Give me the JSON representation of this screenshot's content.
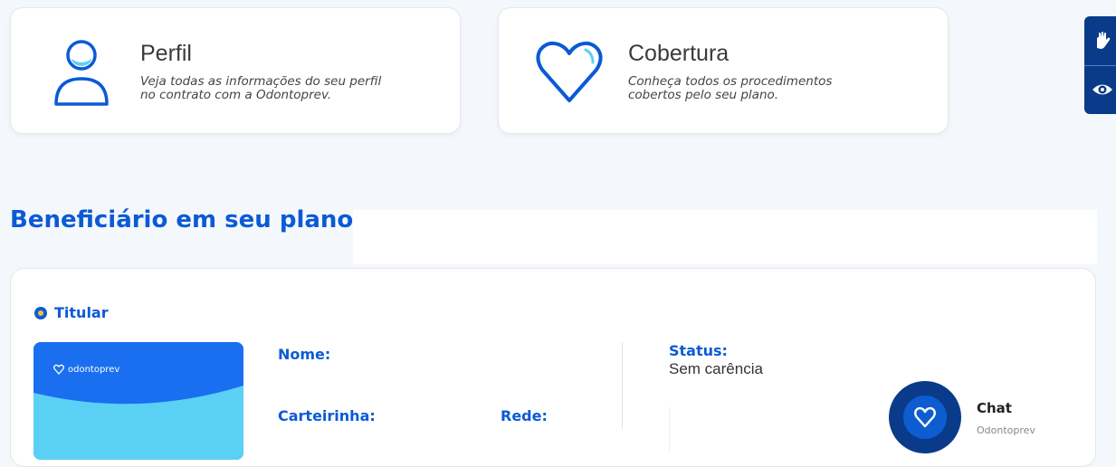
{
  "cards": {
    "perfil": {
      "title": "Perfil",
      "desc_line1": "Veja todas as informações do seu perfil",
      "desc_line2": "no contrato com a Odontoprev."
    },
    "cobertura": {
      "title": "Cobertura",
      "desc_line1": "Conheça todos os procedimentos",
      "desc_line2": "cobertos pelo seu plano."
    }
  },
  "accessibility": {
    "icons": [
      "hand-sign-icon",
      "eye-icon"
    ]
  },
  "section": {
    "title": "Beneficiário em seu plano"
  },
  "beneficiary": {
    "badge_label": "Titular",
    "card_brand": "odontoprev",
    "fields": {
      "nome_label": "Nome:",
      "carteirinha_label": "Carteirinha:",
      "rede_label": "Rede:",
      "status_label": "Status:",
      "status_value": "Sem carência"
    }
  },
  "chat": {
    "title": "Chat",
    "subtitle": "Odontoprev"
  },
  "colors": {
    "primary": "#0b5ad6",
    "dark_blue": "#0a3b8a",
    "card_blue": "#1a6ff0",
    "card_light": "#5bd0f5",
    "background": "#f4f8fc"
  }
}
